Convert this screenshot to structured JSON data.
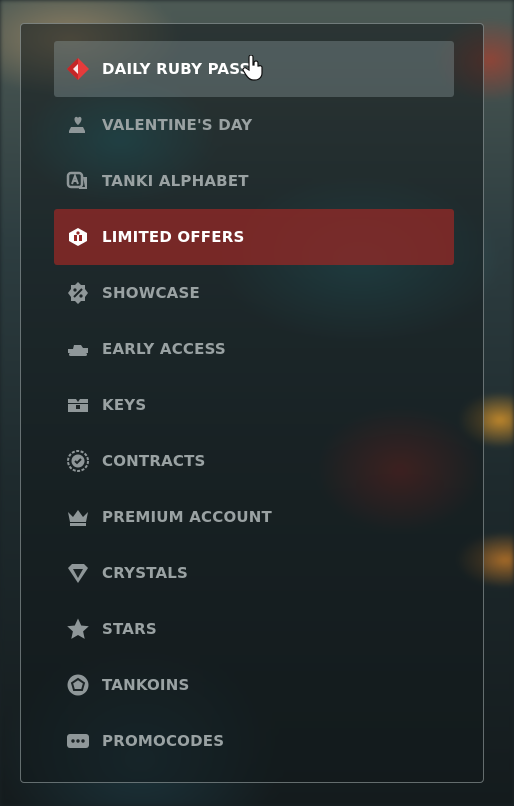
{
  "menu": {
    "items": [
      {
        "label": "DAILY RUBY PASS",
        "icon": "ruby-pass-icon",
        "state": "hover"
      },
      {
        "label": "VALENTINE'S DAY",
        "icon": "heart-tank-icon"
      },
      {
        "label": "TANKI ALPHABET",
        "icon": "alphabet-icon"
      },
      {
        "label": "LIMITED OFFERS",
        "icon": "limited-offers-icon",
        "state": "active"
      },
      {
        "label": "SHOWCASE",
        "icon": "discount-badge-icon"
      },
      {
        "label": "EARLY ACCESS",
        "icon": "tank-icon"
      },
      {
        "label": "KEYS",
        "icon": "key-chest-icon"
      },
      {
        "label": "CONTRACTS",
        "icon": "contract-seal-icon"
      },
      {
        "label": "PREMIUM ACCOUNT",
        "icon": "crown-icon"
      },
      {
        "label": "CRYSTALS",
        "icon": "crystal-icon"
      },
      {
        "label": "STARS",
        "icon": "star-icon"
      },
      {
        "label": "TANKOINS",
        "icon": "tankoin-icon"
      },
      {
        "label": "PROMOCODES",
        "icon": "promocode-icon"
      }
    ]
  },
  "colors": {
    "hover_bg": "#7f8c8e",
    "active_bg": "#962826",
    "text": "#9aa2a3",
    "text_highlight": "#ffffff",
    "ruby": "#e63b3b"
  }
}
